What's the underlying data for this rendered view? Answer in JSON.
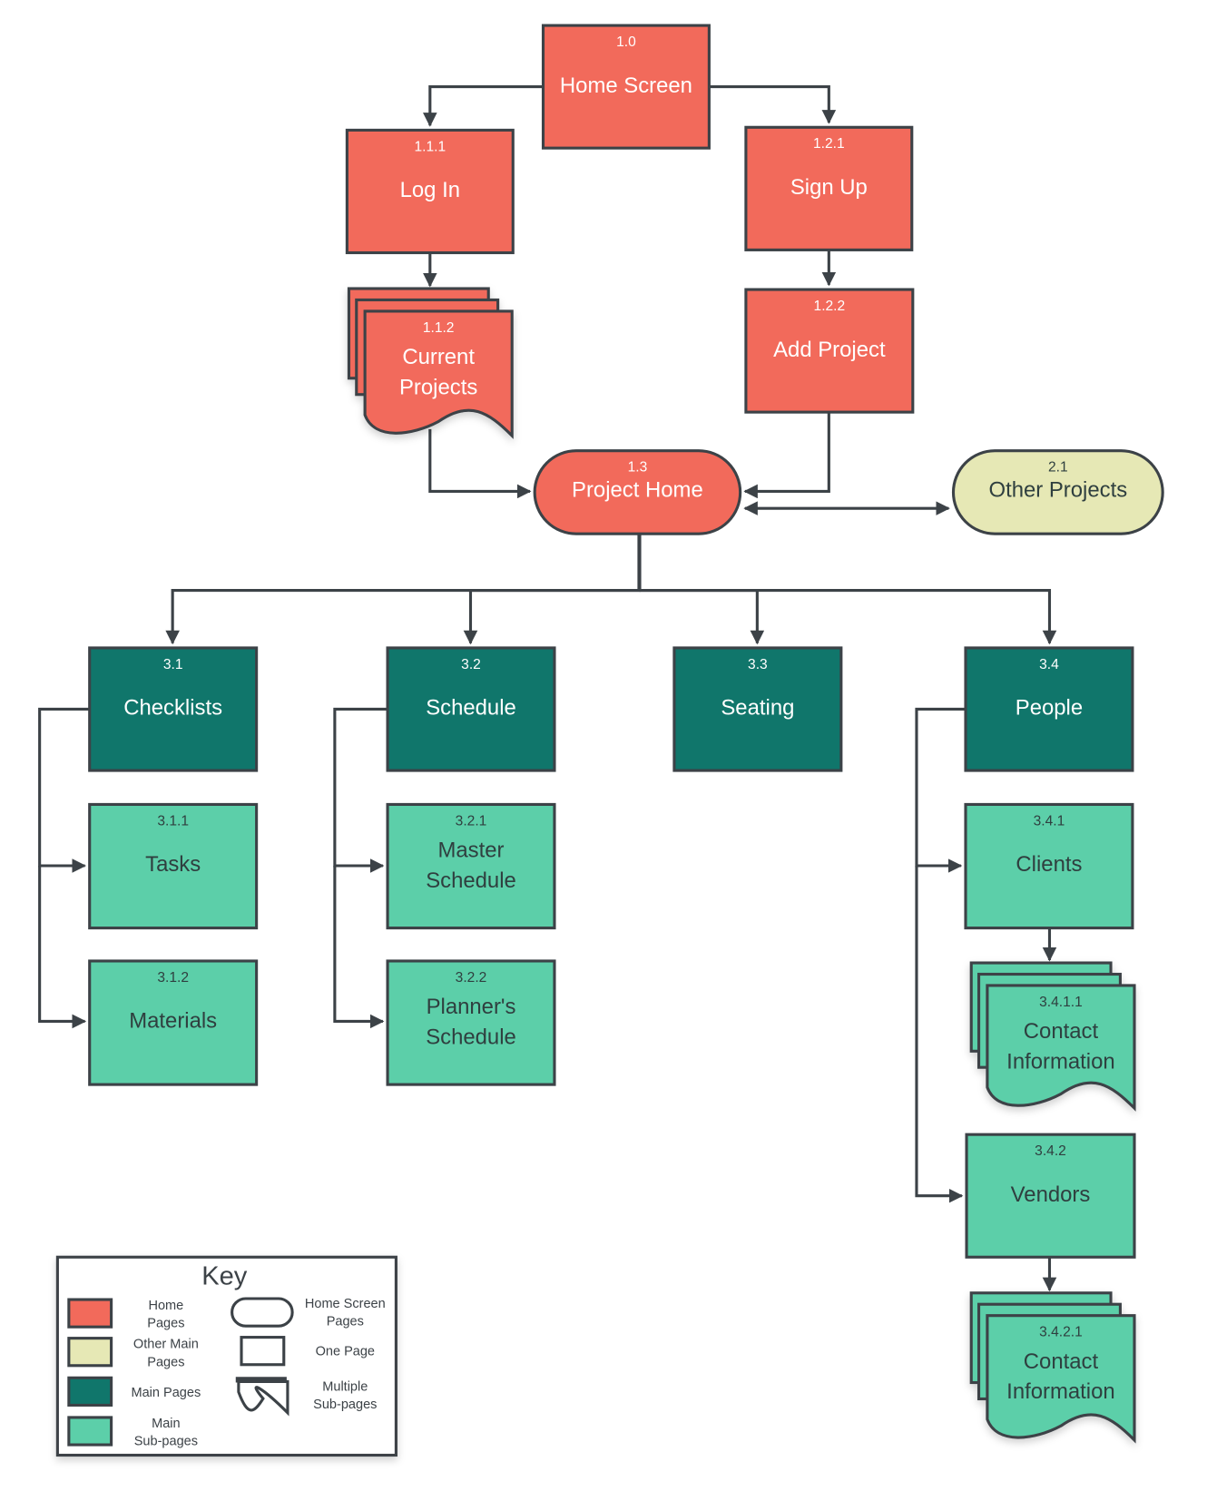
{
  "colors": {
    "home": "#f26a5b",
    "other_main": "#e6e8b5",
    "main": "#10766b",
    "main_sub": "#5ccfa9",
    "stroke": "#3c4247",
    "text_light": "#ffffff",
    "text_dark": "#2f3f3f"
  },
  "nodes": [
    {
      "id": "1.0",
      "label": [
        "Home Screen"
      ],
      "category": "home",
      "shape": "page"
    },
    {
      "id": "1.1.1",
      "label": [
        "Log In"
      ],
      "category": "home",
      "shape": "page"
    },
    {
      "id": "1.2.1",
      "label": [
        "Sign Up"
      ],
      "category": "home",
      "shape": "page"
    },
    {
      "id": "1.1.2",
      "label": [
        "Current",
        "Projects"
      ],
      "category": "home",
      "shape": "multiple"
    },
    {
      "id": "1.2.2",
      "label": [
        "Add Project"
      ],
      "category": "home",
      "shape": "page"
    },
    {
      "id": "1.3",
      "label": [
        "Project Home"
      ],
      "category": "home",
      "shape": "pill"
    },
    {
      "id": "2.1",
      "label": [
        "Other Projects"
      ],
      "category": "other_main",
      "shape": "pill"
    },
    {
      "id": "3.1",
      "label": [
        "Checklists"
      ],
      "category": "main",
      "shape": "page"
    },
    {
      "id": "3.2",
      "label": [
        "Schedule"
      ],
      "category": "main",
      "shape": "page"
    },
    {
      "id": "3.3",
      "label": [
        "Seating"
      ],
      "category": "main",
      "shape": "page"
    },
    {
      "id": "3.4",
      "label": [
        "People"
      ],
      "category": "main",
      "shape": "page"
    },
    {
      "id": "3.1.1",
      "label": [
        "Tasks"
      ],
      "category": "main_sub",
      "shape": "page"
    },
    {
      "id": "3.1.2",
      "label": [
        "Materials"
      ],
      "category": "main_sub",
      "shape": "page"
    },
    {
      "id": "3.2.1",
      "label": [
        "Master",
        "Schedule"
      ],
      "category": "main_sub",
      "shape": "page"
    },
    {
      "id": "3.2.2",
      "label": [
        "Planner's",
        "Schedule"
      ],
      "category": "main_sub",
      "shape": "page"
    },
    {
      "id": "3.4.1",
      "label": [
        "Clients"
      ],
      "category": "main_sub",
      "shape": "page"
    },
    {
      "id": "3.4.1.1",
      "label": [
        "Contact",
        "Information"
      ],
      "category": "main_sub",
      "shape": "multiple"
    },
    {
      "id": "3.4.2",
      "label": [
        "Vendors"
      ],
      "category": "main_sub",
      "shape": "page"
    },
    {
      "id": "3.4.2.1",
      "label": [
        "Contact",
        "Information"
      ],
      "category": "main_sub",
      "shape": "multiple"
    }
  ],
  "edges": [
    {
      "from": "1.0",
      "to": "1.1.1"
    },
    {
      "from": "1.0",
      "to": "1.2.1"
    },
    {
      "from": "1.1.1",
      "to": "1.1.2"
    },
    {
      "from": "1.2.1",
      "to": "1.2.2"
    },
    {
      "from": "1.1.2",
      "to": "1.3"
    },
    {
      "from": "1.2.2",
      "to": "1.3"
    },
    {
      "from": "1.3",
      "to": "2.1",
      "bidirectional": true
    },
    {
      "from": "1.3",
      "to": "3.1"
    },
    {
      "from": "1.3",
      "to": "3.2"
    },
    {
      "from": "1.3",
      "to": "3.3"
    },
    {
      "from": "1.3",
      "to": "3.4"
    },
    {
      "from": "3.1",
      "to": "3.1.1"
    },
    {
      "from": "3.1",
      "to": "3.1.2"
    },
    {
      "from": "3.2",
      "to": "3.2.1"
    },
    {
      "from": "3.2",
      "to": "3.2.2"
    },
    {
      "from": "3.4",
      "to": "3.4.1"
    },
    {
      "from": "3.4",
      "to": "3.4.2"
    },
    {
      "from": "3.4.1",
      "to": "3.4.1.1"
    },
    {
      "from": "3.4.2",
      "to": "3.4.2.1"
    }
  ],
  "key": {
    "title": "Key",
    "colors": [
      {
        "category": "home",
        "label": [
          "Home",
          "Pages"
        ]
      },
      {
        "category": "other_main",
        "label": [
          "Other Main",
          "Pages"
        ]
      },
      {
        "category": "main",
        "label": [
          "Main Pages"
        ]
      },
      {
        "category": "main_sub",
        "label": [
          "Main",
          "Sub-pages"
        ]
      }
    ],
    "shapes": [
      {
        "shape": "pill",
        "label": [
          "Home Screen",
          "Pages"
        ]
      },
      {
        "shape": "page",
        "label": [
          "One Page"
        ]
      },
      {
        "shape": "multiple",
        "label": [
          "Multiple",
          "Sub-pages"
        ]
      }
    ]
  }
}
